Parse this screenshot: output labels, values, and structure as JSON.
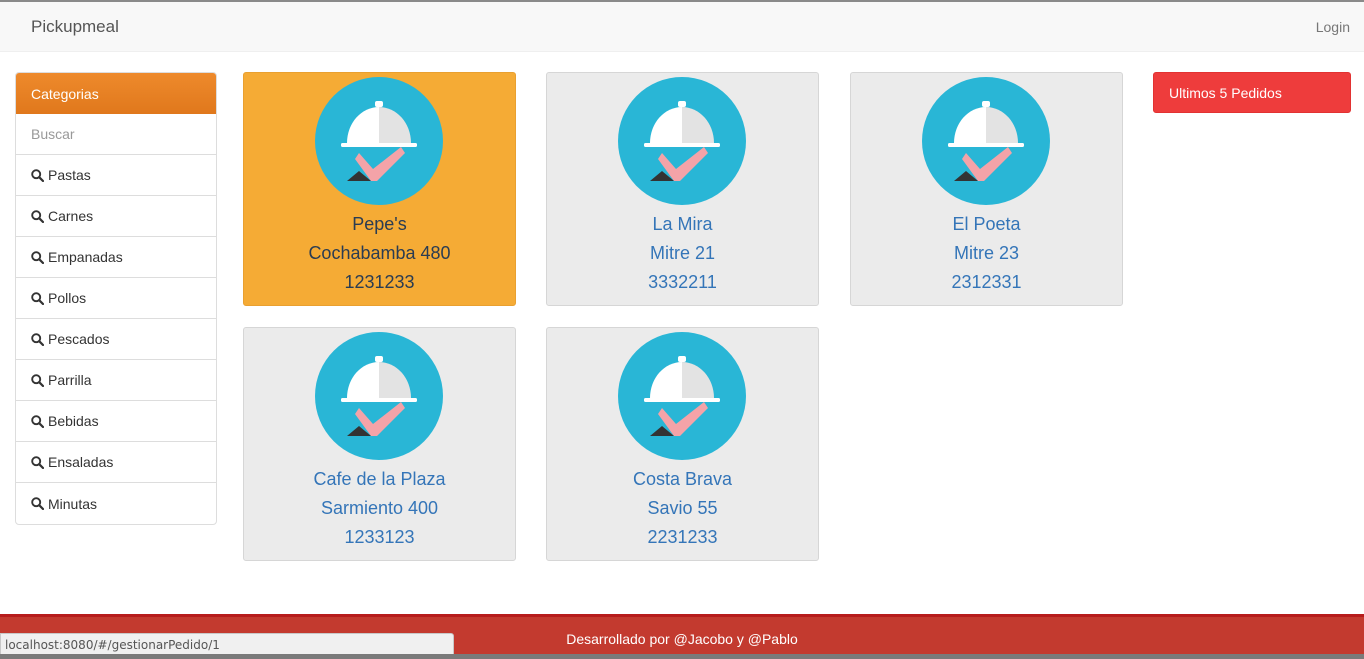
{
  "navbar": {
    "brand": "Pickupmeal",
    "login": "Login"
  },
  "sidebar": {
    "header": "Categorias",
    "search_placeholder": "Buscar",
    "items": [
      {
        "label": "Pastas"
      },
      {
        "label": "Carnes"
      },
      {
        "label": "Empanadas"
      },
      {
        "label": "Pollos"
      },
      {
        "label": "Pescados"
      },
      {
        "label": "Parrilla"
      },
      {
        "label": "Bebidas"
      },
      {
        "label": "Ensaladas"
      },
      {
        "label": "Minutas"
      }
    ]
  },
  "restaurants": [
    {
      "name": "Pepe's",
      "address": "Cochabamba 480",
      "phone": "1231233",
      "selected": true
    },
    {
      "name": "La Mira",
      "address": "Mitre 21",
      "phone": "3332211",
      "selected": false
    },
    {
      "name": "El Poeta",
      "address": "Mitre 23",
      "phone": "2312331",
      "selected": false
    },
    {
      "name": "Cafe de la Plaza",
      "address": "Sarmiento 400",
      "phone": "1233123",
      "selected": false
    },
    {
      "name": "Costa Brava",
      "address": "Savio 55",
      "phone": "2231233",
      "selected": false
    }
  ],
  "orders_panel": {
    "title": "Ultimos 5 Pedidos"
  },
  "footer": {
    "text": "Desarrollado por @Jacobo y @Pablo"
  },
  "status_bar": {
    "url": "localhost:8080/#/gestionarPedido/1"
  },
  "colors": {
    "accent_orange": "#e67e22",
    "card_selected": "#f5ab35",
    "orders_red": "#ee3c3c",
    "footer_red": "#c33a2f",
    "icon_circle": "#29b6d6"
  },
  "icons": {
    "restaurant_logo": "serving-cloche-icon",
    "category": "search-icon"
  }
}
